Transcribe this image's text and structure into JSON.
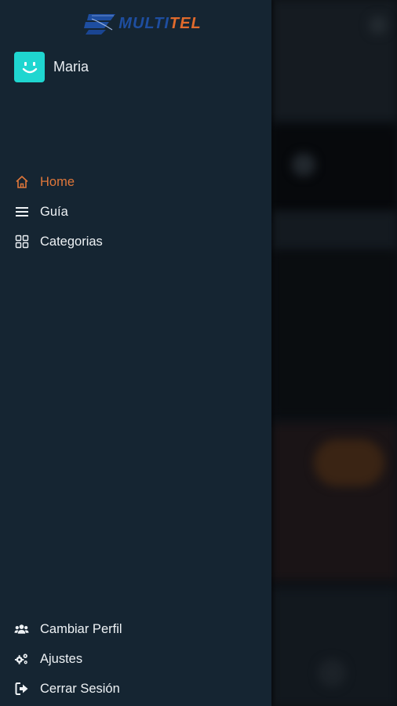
{
  "logo": {
    "part1": "MULTI",
    "part2": "TEL"
  },
  "profile": {
    "name": "Maria"
  },
  "nav": [
    {
      "label": "Home",
      "icon": "home-icon",
      "active": true
    },
    {
      "label": "Guía",
      "icon": "list-icon",
      "active": false
    },
    {
      "label": "Categorias",
      "icon": "grid-icon",
      "active": false
    }
  ],
  "bottom_nav": [
    {
      "label": "Cambiar Perfil",
      "icon": "users-icon"
    },
    {
      "label": "Ajustes",
      "icon": "gears-icon"
    },
    {
      "label": "Cerrar Sesión",
      "icon": "sign-out-icon"
    }
  ],
  "colors": {
    "drawer_bg": "#152532",
    "active": "#e0773a",
    "avatar": "#1fd6d0",
    "logo_blue": "#1e4ea0",
    "logo_orange": "#e06a2c"
  }
}
